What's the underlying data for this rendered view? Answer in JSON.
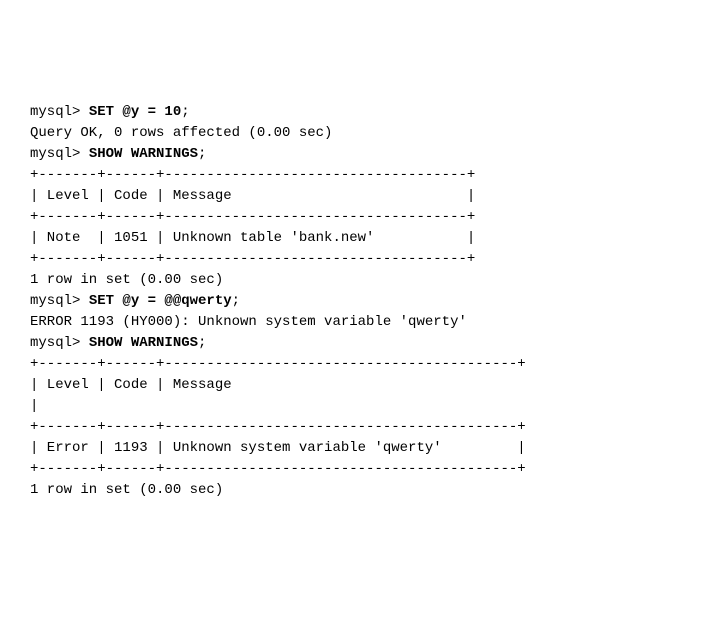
{
  "lines": [
    {
      "segments": [
        {
          "text": "mysql> ",
          "bold": false
        },
        {
          "text": "SET @y = 10",
          "bold": true
        },
        {
          "text": ";",
          "bold": false
        }
      ]
    },
    {
      "segments": [
        {
          "text": "Query OK, 0 rows affected (0.00 sec)",
          "bold": false
        }
      ]
    },
    {
      "segments": [
        {
          "text": "mysql> ",
          "bold": false
        },
        {
          "text": "SHOW WARNINGS",
          "bold": true
        },
        {
          "text": ";",
          "bold": false
        }
      ]
    },
    {
      "segments": [
        {
          "text": "+-------+------+------------------------------------+",
          "bold": false
        }
      ]
    },
    {
      "segments": [
        {
          "text": "| Level | Code | Message                            |",
          "bold": false
        }
      ]
    },
    {
      "segments": [
        {
          "text": "+-------+------+------------------------------------+",
          "bold": false
        }
      ]
    },
    {
      "segments": [
        {
          "text": "| Note  | 1051 | Unknown table 'bank.new'           |",
          "bold": false
        }
      ]
    },
    {
      "segments": [
        {
          "text": "+-------+------+------------------------------------+",
          "bold": false
        }
      ]
    },
    {
      "segments": [
        {
          "text": "1 row in set (0.00 sec)",
          "bold": false
        }
      ]
    },
    {
      "segments": [
        {
          "text": "mysql> ",
          "bold": false
        },
        {
          "text": "SET @y = @@qwerty",
          "bold": true
        },
        {
          "text": ";",
          "bold": false
        }
      ]
    },
    {
      "segments": [
        {
          "text": "ERROR 1193 (HY000): Unknown system variable 'qwerty'",
          "bold": false
        }
      ]
    },
    {
      "segments": [
        {
          "text": "mysql> ",
          "bold": false
        },
        {
          "text": "SHOW WARNINGS",
          "bold": true
        },
        {
          "text": ";",
          "bold": false
        }
      ]
    },
    {
      "segments": [
        {
          "text": "+-------+------+------------------------------------------+",
          "bold": false
        }
      ]
    },
    {
      "segments": [
        {
          "text": "| Level | Code | Message                                  ",
          "bold": false
        }
      ]
    },
    {
      "segments": [
        {
          "text": "|",
          "bold": false
        }
      ]
    },
    {
      "segments": [
        {
          "text": "+-------+------+------------------------------------------+",
          "bold": false
        }
      ]
    },
    {
      "segments": [
        {
          "text": "| Error | 1193 | Unknown system variable 'qwerty'         |",
          "bold": false
        }
      ]
    },
    {
      "segments": [
        {
          "text": "+-------+------+------------------------------------------+",
          "bold": false
        }
      ]
    },
    {
      "segments": [
        {
          "text": "1 row in set (0.00 sec)",
          "bold": false
        }
      ]
    }
  ]
}
